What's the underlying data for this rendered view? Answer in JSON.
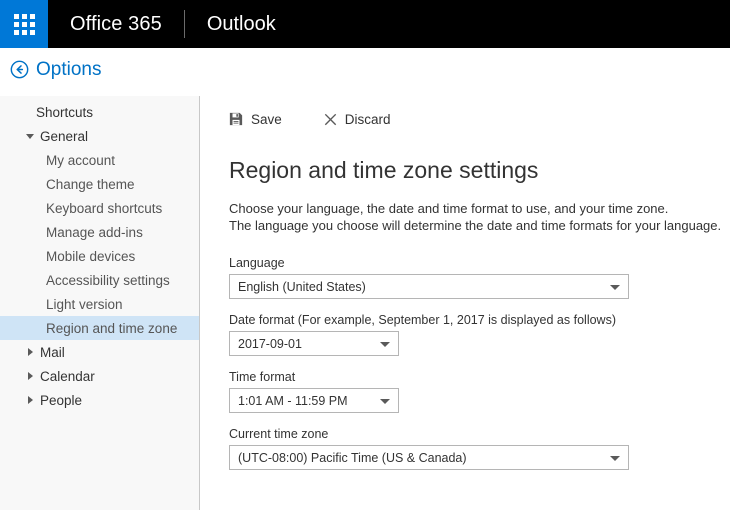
{
  "suite_bar": {
    "waffle_icon": "app-launcher-waffle-icon",
    "brand": "Office 365",
    "app": "Outlook"
  },
  "options_header": {
    "back_icon": "back-circle-arrow-icon",
    "title": "Options"
  },
  "nav": {
    "items": [
      {
        "label": "Shortcuts",
        "level": 0,
        "arrow": "none",
        "selected": false
      },
      {
        "label": "General",
        "level": 0,
        "arrow": "expanded",
        "selected": false
      },
      {
        "label": "My account",
        "level": 1,
        "arrow": "none",
        "selected": false
      },
      {
        "label": "Change theme",
        "level": 1,
        "arrow": "none",
        "selected": false
      },
      {
        "label": "Keyboard shortcuts",
        "level": 1,
        "arrow": "none",
        "selected": false
      },
      {
        "label": "Manage add-ins",
        "level": 1,
        "arrow": "none",
        "selected": false
      },
      {
        "label": "Mobile devices",
        "level": 1,
        "arrow": "none",
        "selected": false
      },
      {
        "label": "Accessibility settings",
        "level": 1,
        "arrow": "none",
        "selected": false
      },
      {
        "label": "Light version",
        "level": 1,
        "arrow": "none",
        "selected": false
      },
      {
        "label": "Region and time zone",
        "level": 1,
        "arrow": "none",
        "selected": true
      },
      {
        "label": "Mail",
        "level": 0,
        "arrow": "collapsed",
        "selected": false
      },
      {
        "label": "Calendar",
        "level": 0,
        "arrow": "collapsed",
        "selected": false
      },
      {
        "label": "People",
        "level": 0,
        "arrow": "collapsed",
        "selected": false
      }
    ]
  },
  "commands": {
    "save_label": "Save",
    "save_icon": "save-floppy-icon",
    "discard_label": "Discard",
    "discard_icon": "close-x-icon"
  },
  "main": {
    "heading": "Region and time zone settings",
    "description_line1": "Choose your language, the date and time format to use, and your time zone.",
    "description_line2": "The language you choose will determine the date and time formats for your language.",
    "fields": {
      "language": {
        "label": "Language",
        "value": "English (United States)"
      },
      "date_format": {
        "label": "Date format (For example, September 1, 2017 is displayed as follows)",
        "value": "2017-09-01"
      },
      "time_format": {
        "label": "Time format",
        "value": "1:01 AM - 11:59 PM"
      },
      "time_zone": {
        "label": "Current time zone",
        "value": "(UTC-08:00) Pacific Time (US & Canada)"
      }
    }
  },
  "colors": {
    "accent_blue": "#0078d7",
    "link_blue": "#0072c6",
    "header_black": "#000000",
    "nav_background": "#f8f8f8",
    "nav_selected": "#cfe4f6"
  }
}
